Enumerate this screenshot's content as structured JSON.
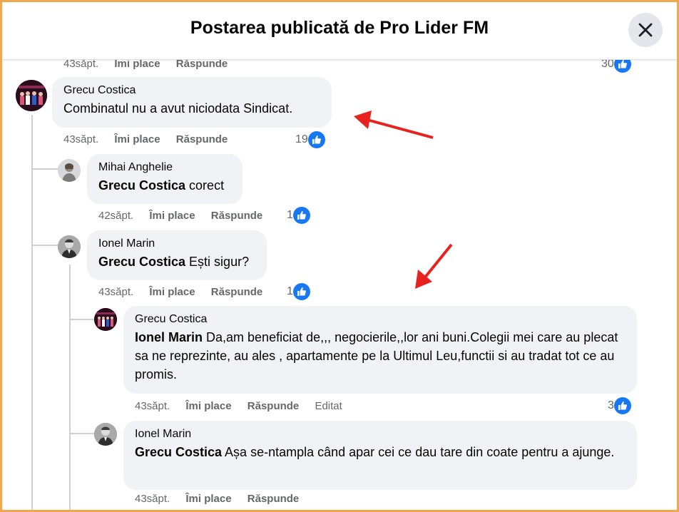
{
  "header": {
    "title": "Postarea publicată de Pro Lider FM",
    "close_icon": "close-icon"
  },
  "top_partial": {
    "time": "43săpt.",
    "like_label": "Îmi place",
    "reply_label": "Răspunde",
    "likes": "30"
  },
  "comments": [
    {
      "author": "Grecu Costica",
      "mention": "",
      "text": "Combinatul nu a avut niciodata Sindicat.",
      "time": "43săpt.",
      "like_label": "Îmi place",
      "reply_label": "Răspunde",
      "likes": "19"
    },
    {
      "author": "Mihai Anghelie",
      "mention": "Grecu Costica",
      "text": " corect",
      "time": "42săpt.",
      "like_label": "Îmi place",
      "reply_label": "Răspunde",
      "likes": "1"
    },
    {
      "author": "Ionel Marin",
      "mention": "Grecu Costica",
      "text": " Ești sigur?",
      "time": "43săpt.",
      "like_label": "Îmi place",
      "reply_label": "Răspunde",
      "likes": "1"
    },
    {
      "author": "Grecu Costica",
      "mention": "Ionel Marin",
      "text": " Da,am beneficiat de,,, negocierile,,lor ani buni.Colegii mei care au plecat sa ne reprezinte, au ales , apartamente pe la Ultimul Leu,functii si au tradat tot ce au promis.",
      "time": "43săpt.",
      "like_label": "Îmi place",
      "reply_label": "Răspunde",
      "edited": "Editat",
      "likes": "3"
    },
    {
      "author": "Ionel Marin",
      "mention": "Grecu Costica",
      "text": " Așa se-ntampla când apar cei ce dau tare din coate pentru a ajunge.",
      "time": "43săpt.",
      "like_label": "Îmi place",
      "reply_label": "Răspunde"
    }
  ],
  "colors": {
    "accent": "#1877f2",
    "bubble": "#f0f2f5",
    "border": "#f0a84c",
    "arrow": "#e8231f"
  }
}
